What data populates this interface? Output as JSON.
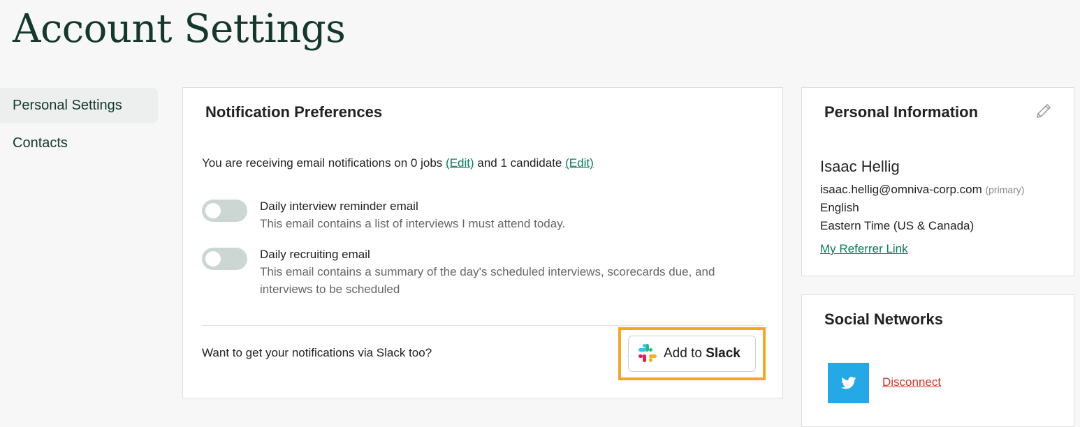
{
  "page": {
    "title": "Account Settings"
  },
  "sidebar": {
    "items": [
      {
        "label": "Personal Settings",
        "active": true
      },
      {
        "label": "Contacts",
        "active": false
      }
    ]
  },
  "notifications": {
    "title": "Notification Preferences",
    "summary_prefix": "You are receiving email notifications on 0 jobs ",
    "edit_jobs_label": "(Edit)",
    "summary_middle": " and 1 candidate ",
    "edit_candidates_label": "(Edit)",
    "preferences": [
      {
        "label": "Daily interview reminder email",
        "description": "This email contains a list of interviews I must attend today.",
        "enabled": false
      },
      {
        "label": "Daily recruiting email",
        "description": "This email contains a summary of the day's scheduled interviews, scorecards due, and interviews to be scheduled",
        "enabled": false
      }
    ],
    "slack_question": "Want to get your notifications via Slack too?",
    "slack_button": {
      "prefix": "Add to ",
      "brand": "Slack"
    },
    "highlight_color": "#f5a623"
  },
  "personal_info": {
    "title": "Personal Information",
    "edit_icon": "pencil-icon",
    "name": "Isaac Hellig",
    "email": "isaac.hellig@omniva-corp.com",
    "email_tag": "(primary)",
    "language": "English",
    "timezone": "Eastern Time (US & Canada)",
    "referrer_link": "My Referrer Link"
  },
  "social_networks": {
    "title": "Social Networks",
    "accounts": [
      {
        "network": "twitter",
        "icon": "twitter-icon",
        "color": "#24a8e6",
        "action": "Disconnect"
      }
    ]
  },
  "colors": {
    "brand_dark": "#15372c",
    "link_green": "#0b7a5c",
    "danger": "#d0342c"
  }
}
